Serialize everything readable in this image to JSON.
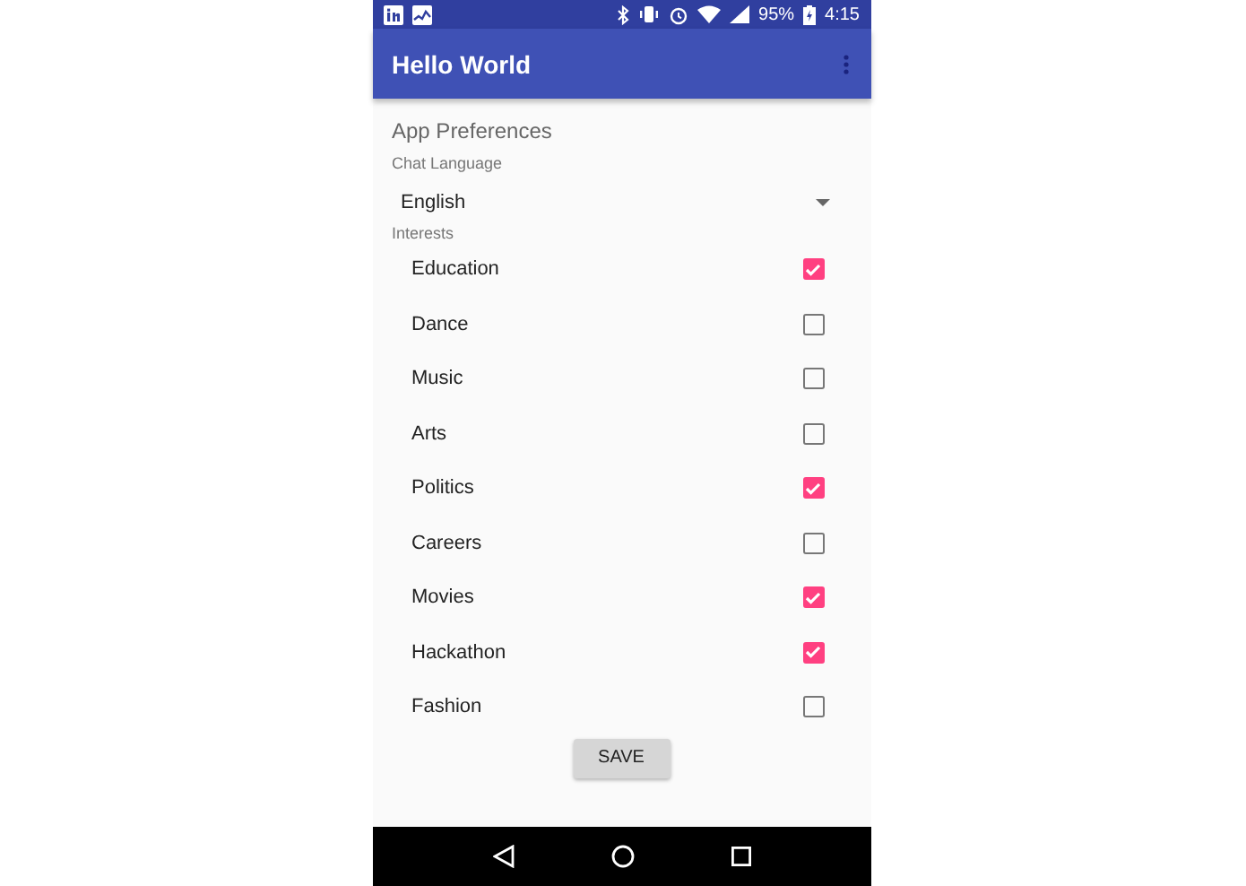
{
  "status_bar": {
    "battery": "95%",
    "time": "4:15"
  },
  "app_bar": {
    "title": "Hello World"
  },
  "preferences": {
    "title": "App Preferences",
    "language_label": "Chat Language",
    "language": "English",
    "interests_label": "Interests",
    "interests": [
      {
        "label": "Education",
        "checked": true
      },
      {
        "label": "Dance",
        "checked": false
      },
      {
        "label": "Music",
        "checked": false
      },
      {
        "label": "Arts",
        "checked": false
      },
      {
        "label": "Politics",
        "checked": true
      },
      {
        "label": "Careers",
        "checked": false
      },
      {
        "label": "Movies",
        "checked": true
      },
      {
        "label": "Hackathon",
        "checked": true
      },
      {
        "label": "Fashion",
        "checked": false
      }
    ]
  },
  "save_button": "SAVE"
}
